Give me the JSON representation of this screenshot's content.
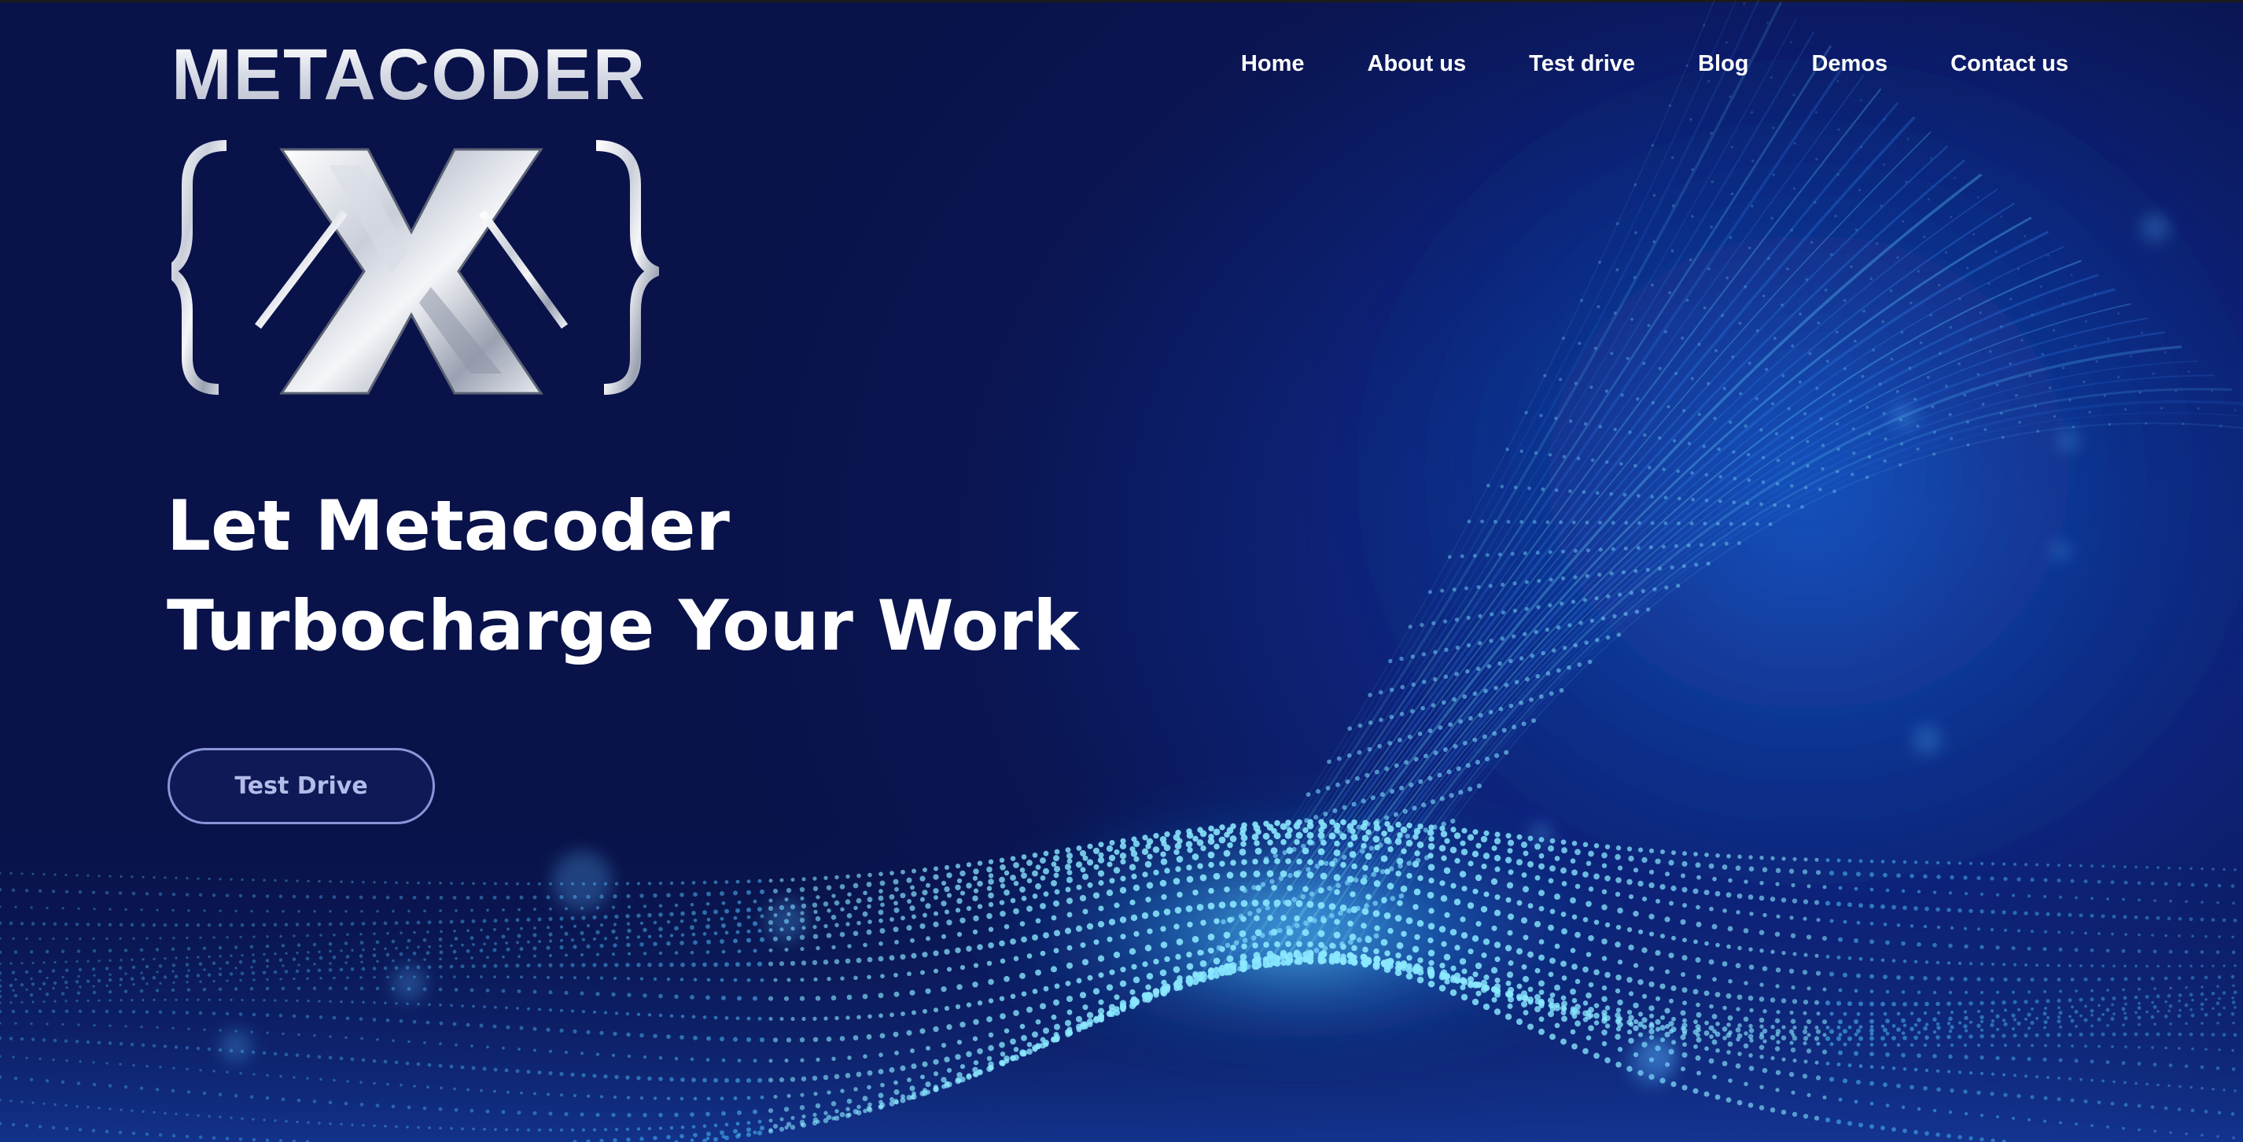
{
  "brand": {
    "wordmark": "METACODER"
  },
  "nav": {
    "items": [
      {
        "label": "Home"
      },
      {
        "label": "About us"
      },
      {
        "label": "Test drive"
      },
      {
        "label": "Blog"
      },
      {
        "label": "Demos"
      },
      {
        "label": "Contact us"
      }
    ]
  },
  "hero": {
    "headline_line1": "Let Metacoder",
    "headline_line2": "Turbocharge Your Work",
    "cta_label": "Test Drive"
  },
  "colors": {
    "background": "#0a1450",
    "accent_glow": "#4fd3ff",
    "text": "#ffffff",
    "cta_border": "#8a95d9"
  },
  "icons": {
    "logo_mark": "x-brackets-logo-icon",
    "background": "particle-wave-background"
  }
}
